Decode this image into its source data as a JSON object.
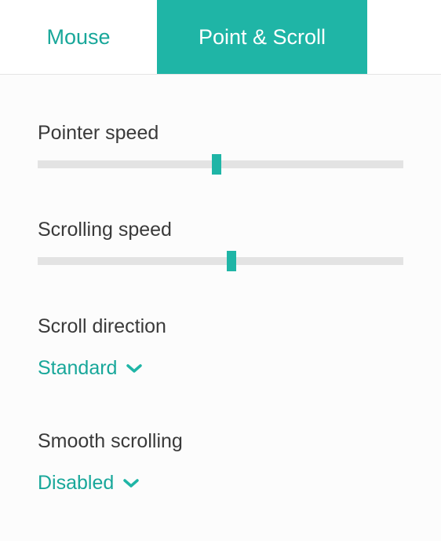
{
  "tabs": {
    "mouse": "Mouse",
    "point_and_scroll": "Point & Scroll"
  },
  "pointer_speed": {
    "label": "Pointer speed",
    "value_percent": 49
  },
  "scrolling_speed": {
    "label": "Scrolling speed",
    "value_percent": 53
  },
  "scroll_direction": {
    "label": "Scroll direction",
    "value": "Standard"
  },
  "smooth_scrolling": {
    "label": "Smooth scrolling",
    "value": "Disabled"
  },
  "colors": {
    "accent": "#1fb5a6",
    "accent_text": "#18a79a",
    "track": "#e3e3e3"
  }
}
